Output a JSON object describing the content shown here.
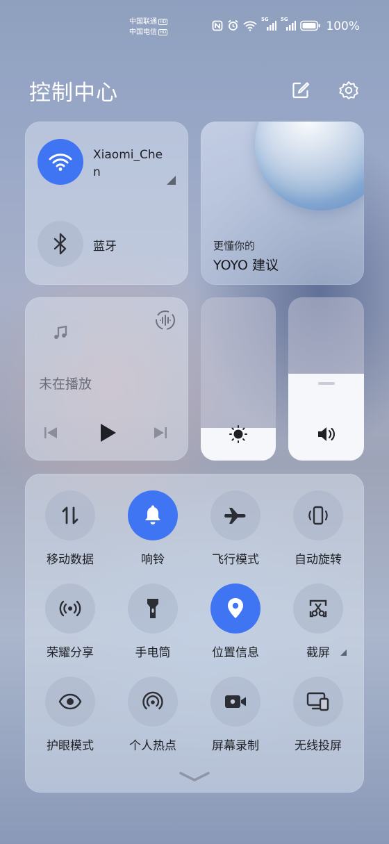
{
  "status_bar": {
    "carrier1": "中国联通",
    "carrier2": "中国电信",
    "carrier_tag": "HD",
    "net1": "5G",
    "net2": "5G",
    "battery": "100%"
  },
  "header": {
    "title": "控制中心",
    "edit_icon": "edit-icon",
    "settings_icon": "gear-icon"
  },
  "wifi": {
    "name": "Xiaomi_Chen",
    "active": true,
    "icon": "wifi-icon"
  },
  "bluetooth": {
    "label": "蓝牙",
    "active": false,
    "icon": "bluetooth-icon"
  },
  "yoyo": {
    "line1": "更懂你的",
    "line2": "YOYO 建议"
  },
  "media": {
    "status": "未在播放",
    "icon": "music-note-icon"
  },
  "brightness": {
    "level": 0.2,
    "icon": "sun-icon"
  },
  "volume": {
    "level": 0.53,
    "icon": "speaker-icon"
  },
  "toggles": [
    {
      "label": "移动数据",
      "icon": "mobile-data-icon",
      "active": false
    },
    {
      "label": "响铃",
      "icon": "bell-icon",
      "active": true
    },
    {
      "label": "飞行模式",
      "icon": "airplane-icon",
      "active": false
    },
    {
      "label": "自动旋转",
      "icon": "rotate-icon",
      "active": false
    },
    {
      "label": "荣耀分享",
      "icon": "share-icon",
      "active": false
    },
    {
      "label": "手电筒",
      "icon": "flashlight-icon",
      "active": false
    },
    {
      "label": "位置信息",
      "icon": "location-icon",
      "active": true
    },
    {
      "label": "截屏",
      "icon": "screenshot-icon",
      "active": false
    },
    {
      "label": "护眼模式",
      "icon": "eye-icon",
      "active": false
    },
    {
      "label": "个人热点",
      "icon": "hotspot-icon",
      "active": false
    },
    {
      "label": "屏幕录制",
      "icon": "screen-record-icon",
      "active": false
    },
    {
      "label": "无线投屏",
      "icon": "cast-icon",
      "active": false
    }
  ],
  "colors": {
    "accent": "#3f74f3"
  }
}
